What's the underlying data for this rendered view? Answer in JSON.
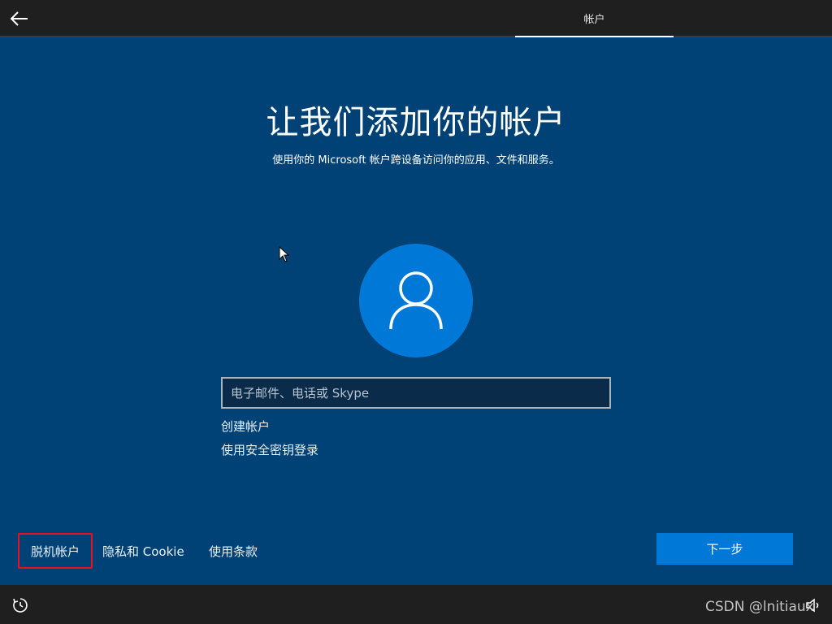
{
  "topbar": {
    "tab_label": "帐户"
  },
  "main": {
    "title": "让我们添加你的帐户",
    "subtitle": "使用你的 Microsoft 帐户跨设备访问你的应用、文件和服务。",
    "email_placeholder": "电子邮件、电话或 Skype",
    "create_account_label": "创建帐户",
    "security_key_label": "使用安全密钥登录"
  },
  "footer": {
    "offline_account_label": "脱机帐户",
    "privacy_label": "隐私和 Cookie",
    "terms_label": "使用条款",
    "next_label": "下一步"
  },
  "watermark": {
    "text": "CSDN @lnitiaux"
  },
  "icons": {
    "back": "arrow-left-icon",
    "avatar": "user-icon",
    "cursor": "mouse-pointer-icon",
    "ease_of_access": "ease-of-access-icon",
    "volume": "volume-icon"
  },
  "colors": {
    "background": "#004275",
    "accent": "#0078d7",
    "bar": "#1f1f1f",
    "highlight_border": "#e81123"
  }
}
